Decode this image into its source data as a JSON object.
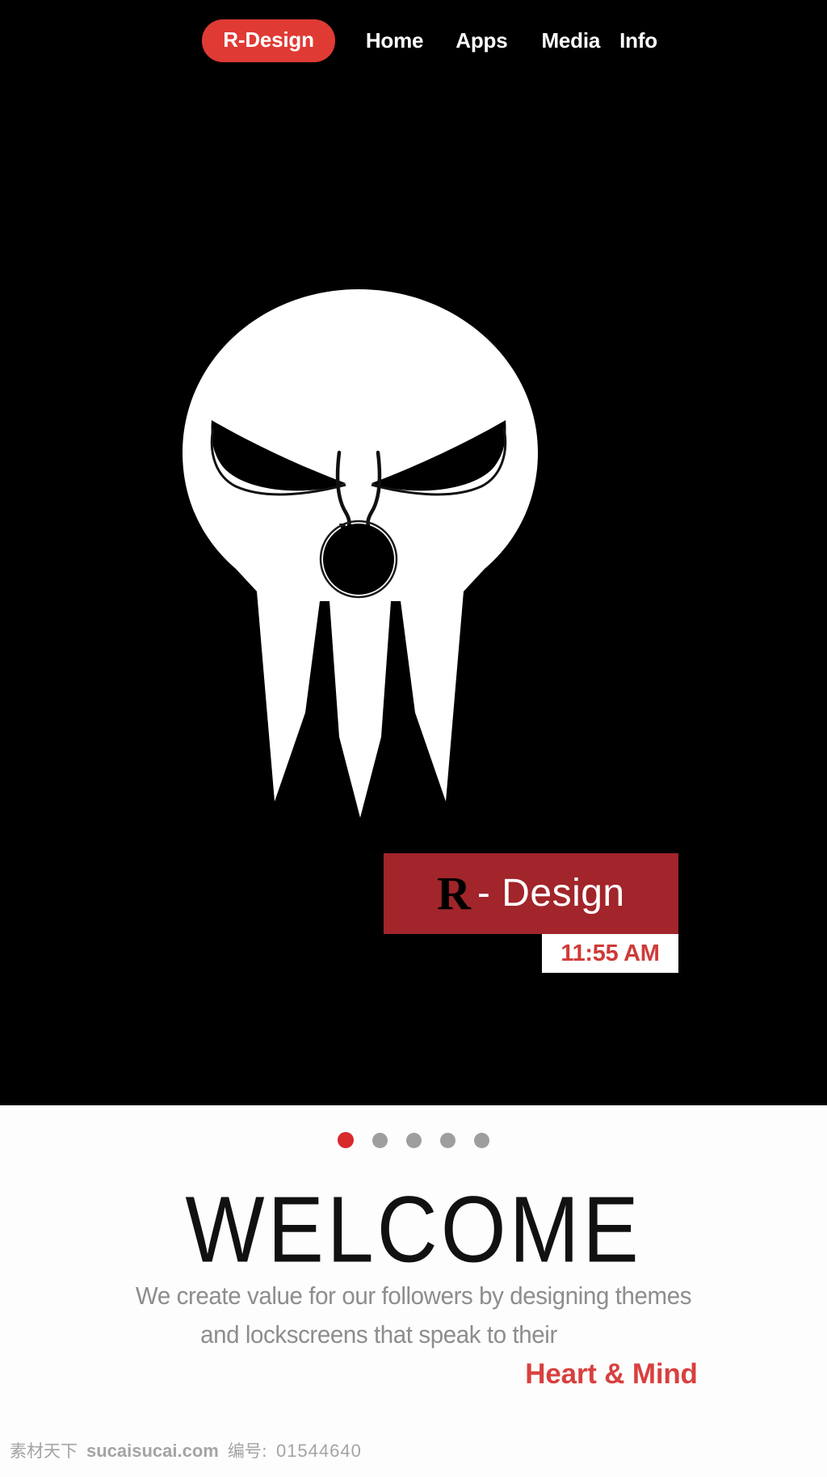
{
  "nav": {
    "brand_pill": "R-Design",
    "items": [
      {
        "label": "Home"
      },
      {
        "label": "Apps"
      },
      {
        "label": "Media"
      },
      {
        "label": "Info"
      }
    ]
  },
  "hero": {
    "logo_name": "angry-skull-logo",
    "brand_badge": {
      "initial": "R",
      "rest": "- Design"
    },
    "time_badge": {
      "time": "11:55 AM"
    }
  },
  "carousel": {
    "total": 5,
    "active_index": 0,
    "dots": [
      {
        "active": true
      },
      {
        "active": false
      },
      {
        "active": false
      },
      {
        "active": false
      },
      {
        "active": false
      }
    ]
  },
  "content": {
    "heading": "WELCOME",
    "paragraph_line_1": "We create value for our followers by designing themes",
    "paragraph_line_2": "and lockscreens that speak to their",
    "tagline": "Heart & Mind"
  },
  "watermark": {
    "site_cn": "素材天下",
    "site_url": "sucaisucai.com",
    "id_label": "编号:",
    "id_value": "01544640"
  },
  "colors": {
    "hero_bg": "#000000",
    "nav_pill_red": "#E03A35",
    "badge_red": "#B2292F",
    "time_red": "#CF3A38",
    "tagline_red": "#D8403E",
    "dot_active": "#D8292B",
    "dot_inactive": "#9E9E9E",
    "body_text_gray": "#8D8D8D"
  }
}
